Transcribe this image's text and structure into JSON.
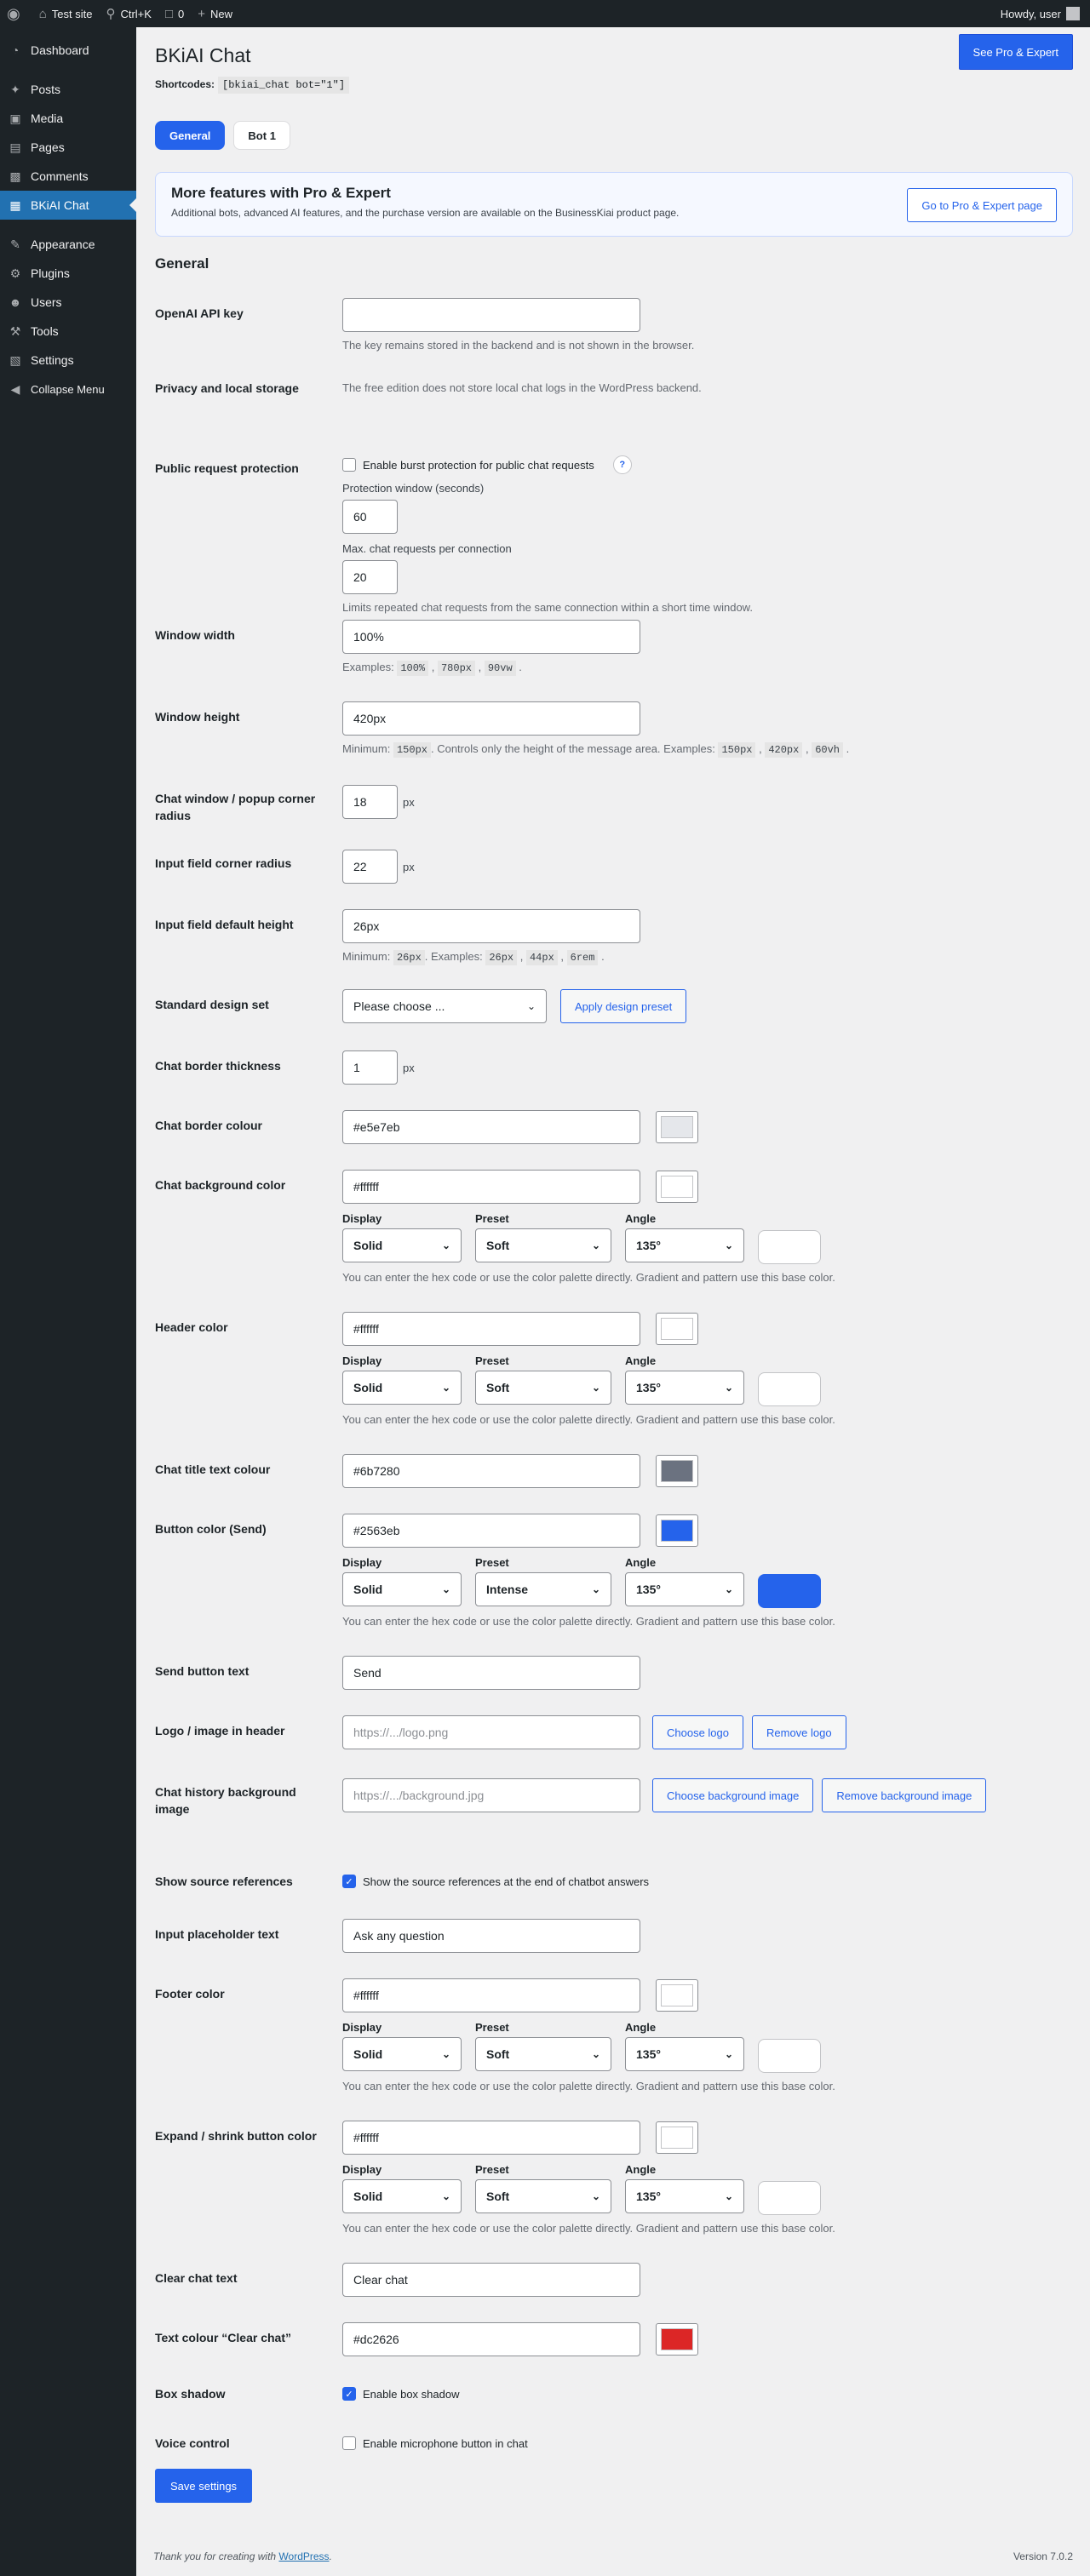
{
  "adminbar": {
    "site": "Test site",
    "shortcut": "Ctrl+K",
    "comments": "0",
    "new": "New",
    "howdy": "Howdy, user"
  },
  "sidebar": {
    "items": [
      "Dashboard",
      "Posts",
      "Media",
      "Pages",
      "Comments",
      "BKiAI Chat",
      "Appearance",
      "Plugins",
      "Users",
      "Tools",
      "Settings",
      "Collapse Menu"
    ]
  },
  "header": {
    "title": "BKiAI Chat",
    "shortcodes_label": "Shortcodes:",
    "shortcode": "[bkiai_chat bot=\"1\"]",
    "pro_button": "See Pro & Expert"
  },
  "tabs": [
    "General",
    "Bot 1"
  ],
  "promo": {
    "title": "More features with Pro & Expert",
    "text": "Additional bots, advanced AI features, and the purchase version are available on the BusinessKiai product page.",
    "button": "Go to Pro & Expert page"
  },
  "section_title": "General",
  "fields": {
    "api": {
      "label": "OpenAI API key",
      "value": "",
      "desc": "The key remains stored in the backend and is not shown in the browser."
    },
    "privacy": {
      "label": "Privacy and local storage",
      "desc": "The free edition does not store local chat logs in the WordPress backend."
    },
    "protection": {
      "label": "Public request protection",
      "checkbox": "Enable burst protection for public chat requests",
      "help": "?",
      "window_label": "Protection window (seconds)",
      "window_value": "60",
      "max_label": "Max. chat requests per connection",
      "max_value": "20",
      "desc": "Limits repeated chat requests from the same connection within a short time window."
    },
    "width": {
      "label": "Window width",
      "value": "100%",
      "desc_prefix": "Examples:",
      "ex1": "100%",
      "ex2": "780px",
      "ex3": "90vw"
    },
    "height": {
      "label": "Window height",
      "value": "420px",
      "desc_min": "Minimum:",
      "min": "150px",
      "desc_mid": ". Controls only the height of the message area. Examples:",
      "ex1": "150px",
      "ex2": "420px",
      "ex3": "60vh"
    },
    "radius": {
      "label": "Chat window / popup corner radius",
      "value": "18",
      "unit": "px"
    },
    "input_radius": {
      "label": "Input field corner radius",
      "value": "22",
      "unit": "px"
    },
    "input_height": {
      "label": "Input field default height",
      "value": "26px",
      "desc_min": "Minimum:",
      "min": "26px",
      "desc_mid": ". Examples:",
      "ex1": "26px",
      "ex2": "44px",
      "ex3": "6rem"
    },
    "design": {
      "label": "Standard design set",
      "select": "Please choose ...",
      "button": "Apply design preset"
    },
    "border_thickness": {
      "label": "Chat border thickness",
      "value": "1",
      "unit": "px"
    },
    "border_colour": {
      "label": "Chat border colour",
      "value": "#e5e7eb",
      "color": "#e5e7eb"
    },
    "bg_color": {
      "label": "Chat background color",
      "value": "#ffffff",
      "color": "#ffffff",
      "display": "Solid",
      "preset": "Soft",
      "angle": "135°"
    },
    "header_color": {
      "label": "Header color",
      "value": "#ffffff",
      "color": "#ffffff",
      "display": "Solid",
      "preset": "Soft",
      "angle": "135°"
    },
    "title_colour": {
      "label": "Chat title text colour",
      "value": "#6b7280",
      "color": "#6b7280"
    },
    "button_color": {
      "label": "Button color (Send)",
      "value": "#2563eb",
      "color": "#2563eb",
      "display": "Solid",
      "preset": "Intense",
      "angle": "135°"
    },
    "send_text": {
      "label": "Send button text",
      "value": "Send"
    },
    "logo": {
      "label": "Logo / image in header",
      "placeholder": "https://.../logo.png",
      "choose": "Choose logo",
      "remove": "Remove logo"
    },
    "history_bg": {
      "label": "Chat history background image",
      "placeholder": "https://.../background.jpg",
      "choose": "Choose background image",
      "remove": "Remove background image"
    },
    "sources": {
      "label": "Show source references",
      "checkbox": "Show the source references at the end of chatbot answers"
    },
    "placeholder": {
      "label": "Input placeholder text",
      "value": "Ask any question"
    },
    "footer_color": {
      "label": "Footer color",
      "value": "#ffffff",
      "color": "#ffffff",
      "display": "Solid",
      "preset": "Soft",
      "angle": "135°"
    },
    "expand_color": {
      "label": "Expand / shrink button color",
      "value": "#ffffff",
      "color": "#ffffff",
      "display": "Solid",
      "preset": "Soft",
      "angle": "135°"
    },
    "clear_text": {
      "label": "Clear chat text",
      "value": "Clear chat"
    },
    "clear_colour": {
      "label": "Text colour “Clear chat”",
      "value": "#dc2626",
      "color": "#dc2626"
    },
    "shadow": {
      "label": "Box shadow",
      "checkbox": "Enable box shadow"
    },
    "voice": {
      "label": "Voice control",
      "checkbox": "Enable microphone button in chat"
    }
  },
  "gradient_labels": {
    "display": "Display",
    "preset": "Preset",
    "angle": "Angle",
    "help": "You can enter the hex code or use the color palette directly. Gradient and pattern use this base color."
  },
  "save_button": "Save settings",
  "footer": {
    "thanks": "Thank you for creating with",
    "link": "WordPress",
    "dot": ".",
    "version": "Version 7.0.2"
  }
}
